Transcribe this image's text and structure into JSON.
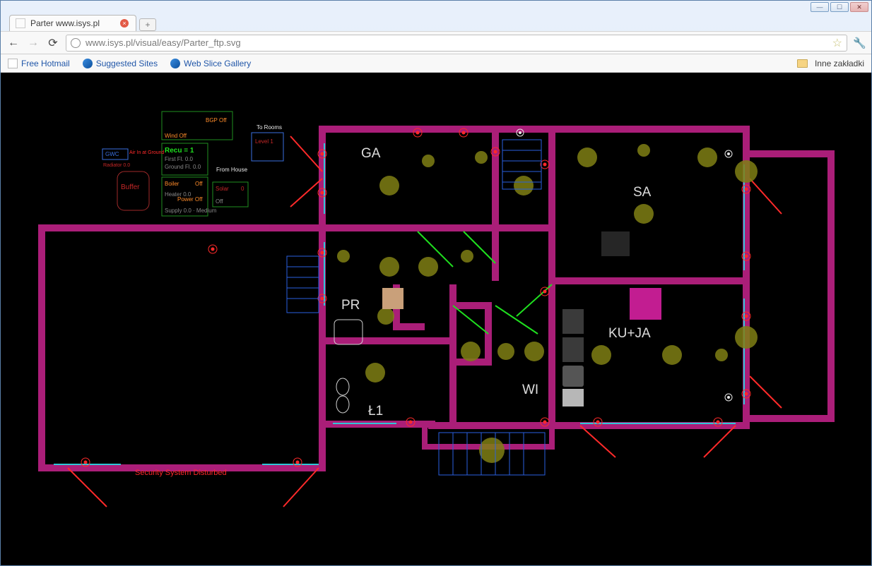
{
  "window": {
    "tab_title": "Parter www.isys.pl",
    "url": "www.isys.pl/visual/easy/Parter_ftp.svg"
  },
  "bookmarks": {
    "b1": "Free Hotmail",
    "b2": "Suggested Sites",
    "b3": "Web Slice Gallery",
    "other": "Inne zakładki"
  },
  "glyphs": {
    "back": "←",
    "fwd": "→",
    "reload": "⟳",
    "star": "☆",
    "wrench": "🔧",
    "minimize": "—",
    "maximize": "☐",
    "close": "✕",
    "plus": "+",
    "tab_x": "×"
  },
  "plan": {
    "rooms": {
      "ga": "GA",
      "sa": "SA",
      "pr": "PR",
      "l1": "Ł1",
      "wi": "WI",
      "kuja": "KU+JA"
    },
    "panel": {
      "gwc": "GWC",
      "air_in_ground": "Air In at Ground",
      "recu": "Recu = 1",
      "bgp_off": "BGP Off",
      "wind_off": "Wind Off",
      "to_rooms": "To Rooms",
      "from_house": "From House",
      "first_fl_0": "First Fl. 0.0",
      "ground_fl_0": "Ground Fl. 0.0",
      "buffer": "Buffer",
      "boiler": "Boiler",
      "boiler_off": "Off",
      "solar": "Solar",
      "solar_0": "0",
      "power_off": "Power Off",
      "supply_medium": "Supply 0.0 · Medium",
      "off": "Off",
      "heater_0": "Heater 0.0",
      "key_0": "Radiator 0.0",
      "level1": "Level 1"
    },
    "status": "Security System Disturbed"
  }
}
